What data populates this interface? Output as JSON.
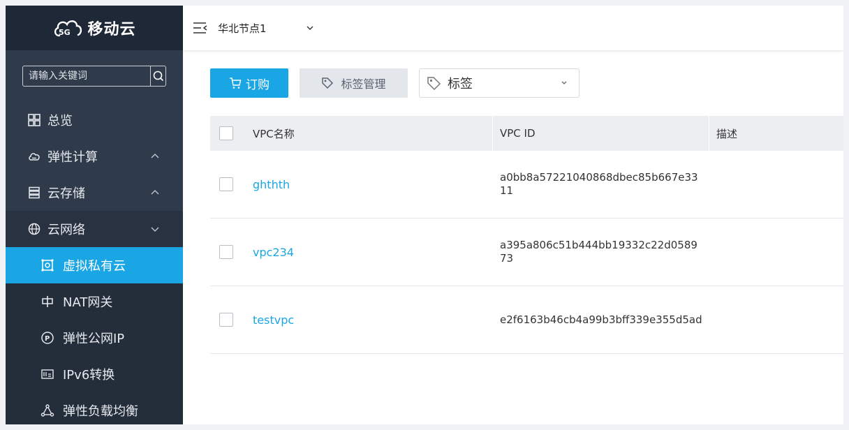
{
  "brand": {
    "logo_badge": "5G",
    "name": "移动云"
  },
  "sidebar": {
    "search_placeholder": "请输入关键词",
    "items": [
      {
        "label": "总览",
        "icon": "grid-icon"
      },
      {
        "label": "弹性计算",
        "icon": "cloud-icon"
      },
      {
        "label": "云存储",
        "icon": "storage-icon"
      },
      {
        "label": "云网络",
        "icon": "globe-icon"
      }
    ],
    "network_sub": [
      {
        "label": "虚拟私有云",
        "icon": "vpc-icon",
        "active": true
      },
      {
        "label": "NAT网关",
        "icon": "nat-icon"
      },
      {
        "label": "弹性公网IP",
        "icon": "ip-icon"
      },
      {
        "label": "IPv6转换",
        "icon": "ipv6-icon"
      },
      {
        "label": "弹性负载均衡",
        "icon": "loadbalancer-icon"
      }
    ]
  },
  "topbar": {
    "region": "华北节点1"
  },
  "toolbar": {
    "order_label": "订购",
    "tag_manage_label": "标签管理",
    "tag_select_label": "标签"
  },
  "table": {
    "headers": {
      "name": "VPC名称",
      "id": "VPC ID",
      "desc": "描述"
    },
    "rows": [
      {
        "name": "ghthth",
        "id": "a0bb8a57221040868dbec85b667e3311",
        "desc": ""
      },
      {
        "name": "vpc234",
        "id": "a395a806c51b444bb19332c22d058973",
        "desc": ""
      },
      {
        "name": "testvpc",
        "id": "e2f6163b46cb4a99b3bff339e355d5ad",
        "desc": ""
      }
    ]
  },
  "colors": {
    "accent": "#1aa6e4",
    "sidebar": "#2f3a4a",
    "sidebar_dark": "#1f2836"
  }
}
